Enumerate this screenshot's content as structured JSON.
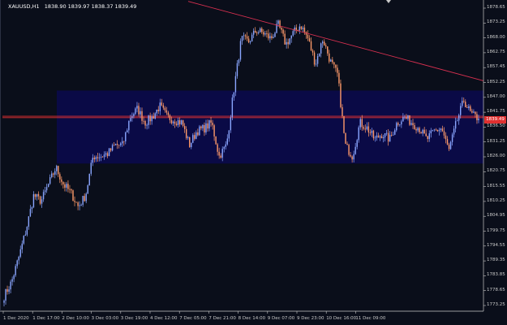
{
  "window": {
    "symbol": "XAUUSD,H1",
    "ohlc": "1838.90 1839.97 1838.37 1839.49"
  },
  "price_badge": "1839.49",
  "colors": {
    "background": "#0a0e1a",
    "bull_candle": "#8aa6ff",
    "bear_candle": "#ff9a6a",
    "zone_fill": "#0a0a46",
    "horizontal_line": "#e03030",
    "trend_line": "#d83050",
    "axis": "#c8c8c8"
  },
  "y_axis": {
    "ticks": [
      "1878.65",
      "1873.25",
      "1868.00",
      "1862.75",
      "1857.45",
      "1852.25",
      "1847.00",
      "1841.75",
      "1836.50",
      "1831.25",
      "1826.00",
      "1820.75",
      "1815.55",
      "1810.25",
      "1804.95",
      "1799.75",
      "1794.55",
      "1789.35",
      "1783.85",
      "1778.65",
      "1773.25"
    ]
  },
  "x_axis": {
    "ticks": [
      "1 Dec 2020",
      "1 Dec 17:00",
      "2 Dec 10:00",
      "3 Dec 03:00",
      "3 Dec 19:00",
      "4 Dec 12:00",
      "7 Dec 05:00",
      "7 Dec 21:00",
      "8 Dec 14:00",
      "9 Dec 07:00",
      "9 Dec 23:00",
      "10 Dec 16:00",
      "11 Dec 09:00"
    ]
  },
  "chart_data": {
    "type": "candlestick",
    "y_range": [
      1770.6,
      1881.3
    ],
    "horizontal_lines": [
      1840.3,
      1839.8
    ],
    "zone": {
      "from": 1823.4,
      "to": 1849.5
    },
    "trend_line": {
      "from": 1881.4,
      "to": 1853.0
    },
    "path": [
      1776,
      1781,
      1790,
      1800,
      1812,
      1810,
      1816,
      1822,
      1816,
      1813,
      1808,
      1812,
      1826,
      1826,
      1827,
      1830,
      1830,
      1840,
      1843,
      1838,
      1840,
      1844,
      1840,
      1839,
      1838,
      1830,
      1835,
      1836,
      1838,
      1826,
      1830,
      1850,
      1868,
      1867,
      1871,
      1870,
      1868,
      1873,
      1866,
      1870,
      1873,
      1868,
      1859,
      1868,
      1860,
      1855,
      1830,
      1826,
      1838,
      1836,
      1832,
      1834,
      1832,
      1838,
      1840,
      1838,
      1836,
      1832,
      1835,
      1836,
      1828,
      1838,
      1846,
      1841,
      1839.49
    ],
    "last": 1839.49
  }
}
